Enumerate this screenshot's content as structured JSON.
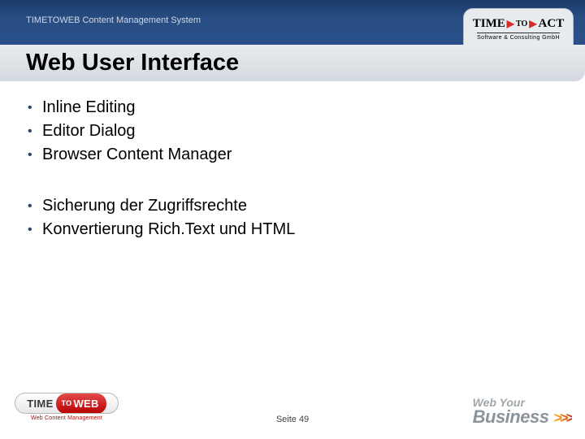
{
  "header": {
    "breadcrumb": "TIMETOWEB Content Management System",
    "title": "Web User Interface"
  },
  "company_badge": {
    "name_part1": "TIME",
    "name_part2": "ACT",
    "connector": "TO",
    "subtitle": "Software & Consulting GmbH"
  },
  "bullets": {
    "group1": [
      "Inline Editing",
      "Editor Dialog",
      "Browser Content Manager"
    ],
    "group2": [
      "Sicherung der Zugriffsrechte",
      "Konvertierung Rich.Text und HTML"
    ]
  },
  "footer": {
    "page_label": "Seite 49",
    "ttw_logo": {
      "part1": "TIME",
      "connector": "TO",
      "part2": "WEB",
      "sub": "Web Content Management"
    },
    "wyb": {
      "line1": "Web Your",
      "line2": "Business",
      "chevrons": ">>>"
    }
  }
}
